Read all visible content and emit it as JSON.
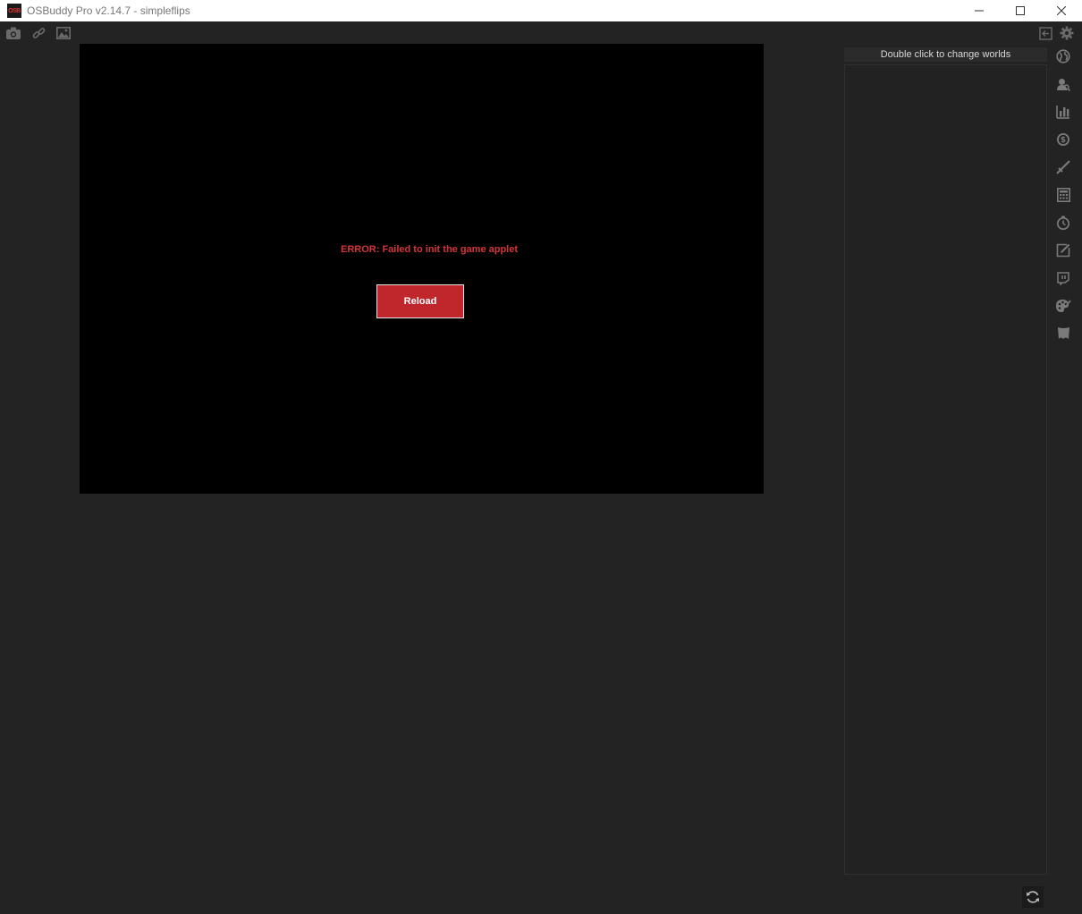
{
  "window": {
    "logo_text": "OSB",
    "title": "OSBuddy Pro v2.14.7 - simpleflips",
    "controls": [
      "minimize-icon",
      "maximize-icon",
      "close-icon"
    ]
  },
  "toolbar": {
    "left_icons": [
      "camera-icon",
      "link-icon",
      "image-icon"
    ],
    "right_icons": [
      "exit-icon",
      "gear-icon"
    ]
  },
  "game": {
    "error_message": "ERROR: Failed to init the game applet",
    "reload_label": "Reload"
  },
  "world_panel": {
    "header": "Double click to change worlds"
  },
  "sidebar": {
    "icons": [
      "globe-icon",
      "hiscores-icon",
      "bar-chart-icon",
      "coin-icon",
      "sword-icon",
      "calculator-icon",
      "timer-icon",
      "notes-icon",
      "twitch-icon",
      "palette-icon",
      "map-icon"
    ]
  },
  "footer": {
    "refresh_icon": "refresh-icon"
  },
  "colors": {
    "background": "#232323",
    "error": "#d3343a",
    "reload_button": "#c0272d"
  }
}
